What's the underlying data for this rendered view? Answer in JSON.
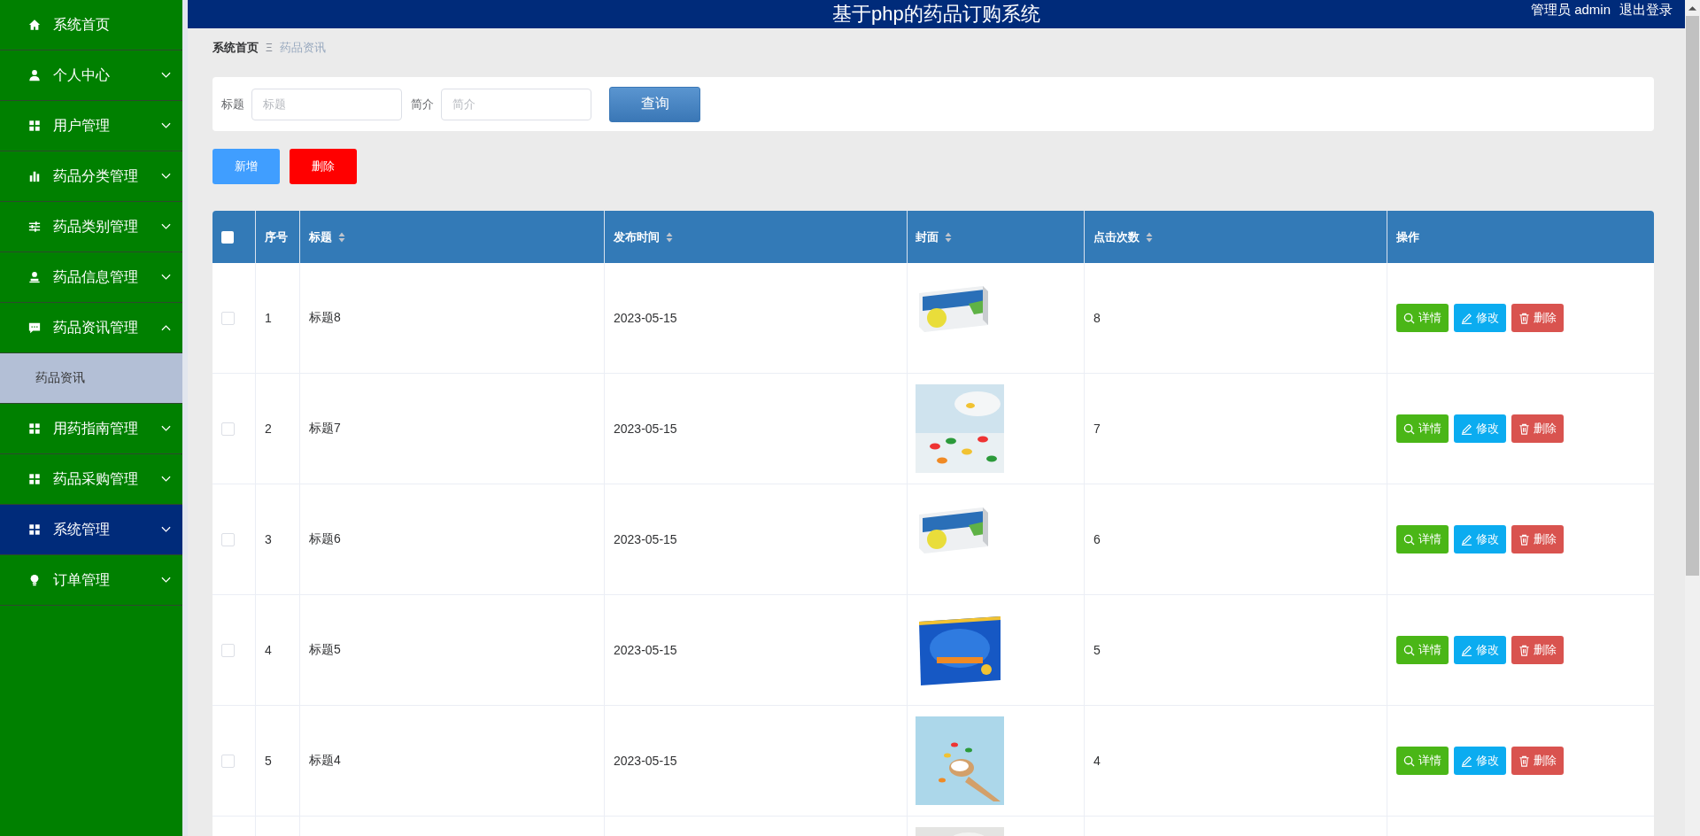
{
  "header": {
    "title": "基于php的药品订购系统",
    "user": "管理员 admin",
    "logout": "退出登录"
  },
  "sidebar": {
    "items": [
      {
        "label": "系统首页",
        "selected": false
      },
      {
        "label": "个人中心",
        "selected": false,
        "expanded": false
      },
      {
        "label": "用户管理",
        "selected": false,
        "expanded": false
      },
      {
        "label": "药品分类管理",
        "selected": false,
        "expanded": false
      },
      {
        "label": "药品类别管理",
        "selected": false,
        "expanded": false
      },
      {
        "label": "药品信息管理",
        "selected": false,
        "expanded": false
      },
      {
        "label": "药品资讯管理",
        "selected": false,
        "expanded": true,
        "children": [
          {
            "label": "药品资讯",
            "selected": true
          }
        ]
      },
      {
        "label": "用药指南管理",
        "selected": false,
        "expanded": false
      },
      {
        "label": "药品采购管理",
        "selected": false,
        "expanded": false
      },
      {
        "label": "系统管理",
        "selected": true,
        "expanded": false
      },
      {
        "label": "订单管理",
        "selected": false,
        "expanded": false
      }
    ]
  },
  "breadcrumb": [
    {
      "label": "系统首页",
      "current": false
    },
    {
      "label": "药品资讯",
      "current": true
    }
  ],
  "breadcrumb_separator": "Ξ",
  "search": {
    "fields": [
      {
        "label": "标题",
        "placeholder": "标题"
      },
      {
        "label": "简介",
        "placeholder": "简介"
      }
    ],
    "button": "查询"
  },
  "actions": [
    {
      "label": "新增",
      "kind": "add"
    },
    {
      "label": "删除",
      "kind": "delete"
    }
  ],
  "table": {
    "header_checkbox": {
      "checked": false
    },
    "columns": [
      {
        "label": "序号",
        "sortable": false
      },
      {
        "label": "标题",
        "sortable": true
      },
      {
        "label": "发布时间",
        "sortable": true
      },
      {
        "label": "封面",
        "sortable": true
      },
      {
        "label": "点击次数",
        "sortable": true
      },
      {
        "label": "操作",
        "sortable": false
      }
    ],
    "rows": [
      {
        "checked": false,
        "index": "1",
        "title": "标题8",
        "date": "2023-05-15",
        "cover": {
          "kind": "picture"
        },
        "clicks": "8",
        "buttons": [
          {
            "label": "详情",
            "kind": "detail"
          },
          {
            "label": "修改",
            "kind": "edit"
          },
          {
            "label": "删除",
            "kind": "delete"
          }
        ]
      },
      {
        "checked": false,
        "index": "2",
        "title": "标题7",
        "date": "2023-05-15",
        "cover": {
          "kind": "picture"
        },
        "clicks": "7",
        "buttons": [
          {
            "label": "详情",
            "kind": "detail"
          },
          {
            "label": "修改",
            "kind": "edit"
          },
          {
            "label": "删除",
            "kind": "delete"
          }
        ]
      },
      {
        "checked": false,
        "index": "3",
        "title": "标题6",
        "date": "2023-05-15",
        "cover": {
          "kind": "picture"
        },
        "clicks": "6",
        "buttons": [
          {
            "label": "详情",
            "kind": "detail"
          },
          {
            "label": "修改",
            "kind": "edit"
          },
          {
            "label": "删除",
            "kind": "delete"
          }
        ]
      },
      {
        "checked": false,
        "index": "4",
        "title": "标题5",
        "date": "2023-05-15",
        "cover": {
          "kind": "picture"
        },
        "clicks": "5",
        "buttons": [
          {
            "label": "详情",
            "kind": "detail"
          },
          {
            "label": "修改",
            "kind": "edit"
          },
          {
            "label": "删除",
            "kind": "delete"
          }
        ]
      },
      {
        "checked": false,
        "index": "5",
        "title": "标题4",
        "date": "2023-05-15",
        "cover": {
          "kind": "picture"
        },
        "clicks": "4",
        "buttons": [
          {
            "label": "详情",
            "kind": "detail"
          },
          {
            "label": "修改",
            "kind": "edit"
          },
          {
            "label": "删除",
            "kind": "delete"
          }
        ]
      },
      {
        "cover": {
          "kind": "picture"
        }
      }
    ]
  }
}
